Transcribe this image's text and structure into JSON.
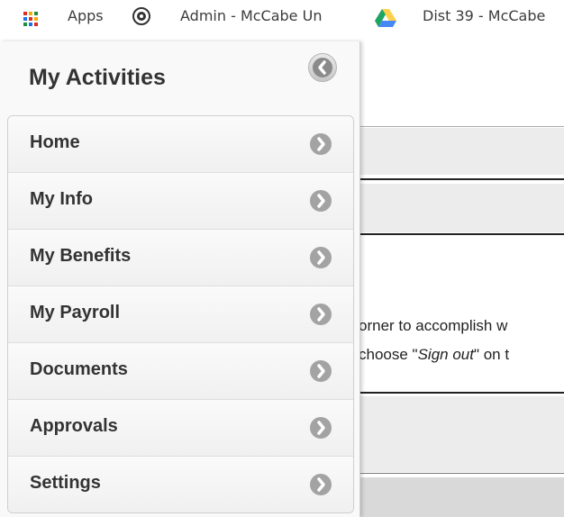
{
  "bookmarks": [
    {
      "label": "Apps",
      "icon": "apps-grid-icon"
    },
    {
      "label": "Admin - McCabe Un",
      "icon": "admin-globe-icon"
    },
    {
      "label": "Dist 39 - McCabe",
      "icon": "google-drive-icon"
    }
  ],
  "panel": {
    "title": "My Activities",
    "items": [
      {
        "label": "Home"
      },
      {
        "label": "My Info"
      },
      {
        "label": "My Benefits"
      },
      {
        "label": "My Payroll"
      },
      {
        "label": "Documents"
      },
      {
        "label": "Approvals"
      },
      {
        "label": "Settings"
      }
    ]
  },
  "background": {
    "line1": "orner to accomplish w",
    "line2_prefix": "choose \"",
    "line2_em": "Sign out",
    "line2_suffix": "\" on t"
  },
  "colors": {
    "drive_green": "#1fa463",
    "drive_yellow": "#ffd04b",
    "drive_blue": "#4688f4",
    "arrow_gray": "#a3a3a3"
  }
}
